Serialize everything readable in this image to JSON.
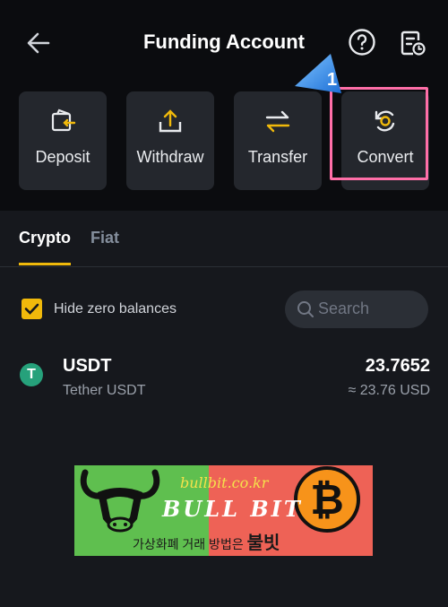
{
  "header": {
    "title": "Funding Account"
  },
  "actions": [
    {
      "label": "Deposit"
    },
    {
      "label": "Withdraw"
    },
    {
      "label": "Transfer"
    },
    {
      "label": "Convert"
    }
  ],
  "annotation": {
    "step_number": "1",
    "highlight_color": "#ff6fa8"
  },
  "tabs": [
    {
      "label": "Crypto",
      "active": true
    },
    {
      "label": "Fiat",
      "active": false
    }
  ],
  "filters": {
    "hide_zero_label": "Hide zero balances",
    "hide_zero_checked": true
  },
  "search": {
    "placeholder": "Search"
  },
  "assets": [
    {
      "symbol": "USDT",
      "name": "Tether USDT",
      "amount": "23.7652",
      "usd_value": "≈ 23.76 USD",
      "icon_letter": "T"
    }
  ],
  "banner": {
    "url": "bullbit.co.kr",
    "brand": "BULL BIT",
    "tagline": "가상화폐 거래 방법은",
    "tagline_brand": "불빗"
  },
  "colors": {
    "accent": "#f0b90b",
    "background": "#16181d",
    "tether_green": "#26a17b"
  }
}
